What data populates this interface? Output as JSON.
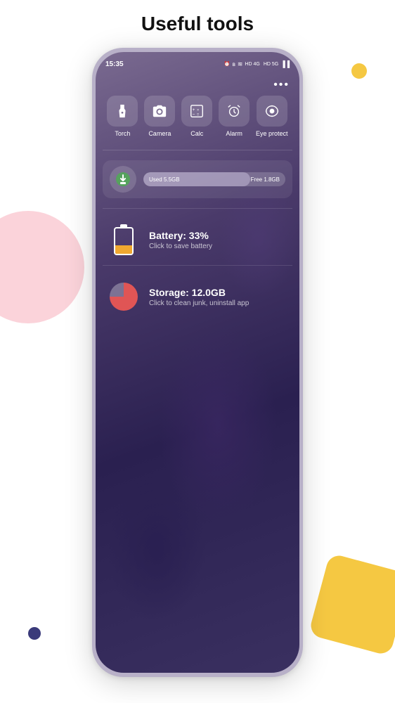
{
  "page": {
    "title": "Useful tools"
  },
  "status_bar": {
    "time": "15:35",
    "right_icons": "⏰ ʙ ≋ ᴴᴰ 4G ᴴᴰ 5G ▐▐"
  },
  "menu": {
    "dots": "•••"
  },
  "tools": [
    {
      "id": "torch",
      "label": "Torch",
      "icon": "torch"
    },
    {
      "id": "camera",
      "label": "Camera",
      "icon": "camera"
    },
    {
      "id": "calc",
      "label": "Calc",
      "icon": "calc"
    },
    {
      "id": "alarm",
      "label": "Alarm",
      "icon": "alarm"
    },
    {
      "id": "eye_protect",
      "label": "Eye protect",
      "icon": "eye"
    }
  ],
  "storage_bar": {
    "used_label": "Used 5.5GB",
    "free_label": "Free 1.8GB",
    "used_percent": 75
  },
  "battery": {
    "title": "Battery: 33%",
    "subtitle": "Click to save battery",
    "percent": 33
  },
  "storage": {
    "title": "Storage: 12.0GB",
    "subtitle": "Click to clean junk, uninstall app",
    "used_percent": 75
  },
  "decorations": {
    "blob_pink": true,
    "blob_yellow_dot": true,
    "blob_yellow_shape": true,
    "blob_navy_dot": true
  },
  "colors": {
    "accent_yellow": "#f5c842",
    "accent_pink": "#f9c0cb",
    "accent_navy": "#3a3a7a",
    "battery_fill": "#f0a830",
    "storage_fill": "#e05555"
  }
}
